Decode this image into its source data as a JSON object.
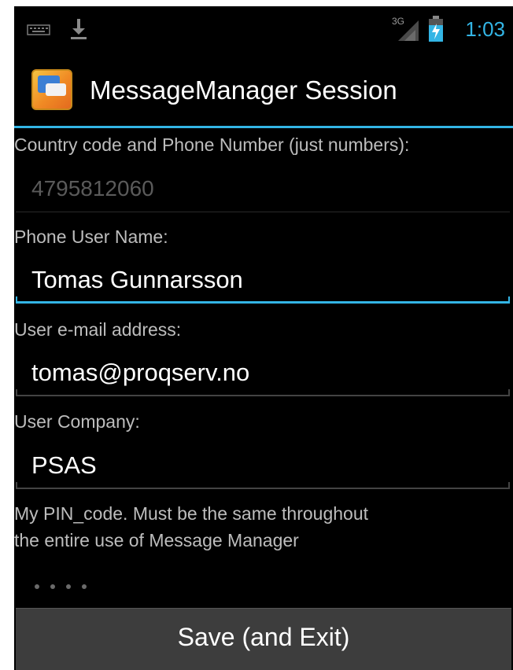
{
  "status_bar": {
    "time": "1:03",
    "network_label": "3G",
    "icons": [
      "keyboard-icon",
      "download-icon",
      "signal-icon",
      "battery-icon"
    ]
  },
  "action_bar": {
    "title": "MessageManager Session",
    "icon": "app-icon"
  },
  "form": {
    "phone": {
      "label": "Country code and Phone Number (just numbers):",
      "value": "4795812060",
      "enabled": false
    },
    "user_name": {
      "label": "Phone User Name:",
      "value": "Tomas Gunnarsson",
      "focused": true
    },
    "email": {
      "label": "User e-mail address:",
      "value": "tomas@proqserv.no"
    },
    "company": {
      "label": "User Company:",
      "value": "PSAS"
    },
    "pin": {
      "label_line1": "My PIN_code. Must be the same throughout",
      "label_line2": "the entire use of Message Manager",
      "masked_length": 4
    }
  },
  "save_button": {
    "label": "Save (and Exit)"
  },
  "colors": {
    "accent": "#33b5e5",
    "background": "#000000",
    "button": "#3d3d3d"
  }
}
